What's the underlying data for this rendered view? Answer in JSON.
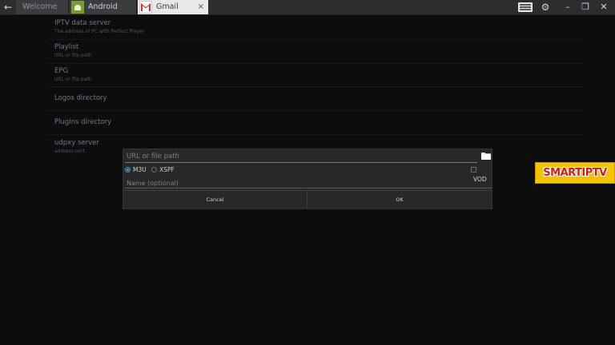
{
  "tabs": [
    {
      "label": "Welcome"
    },
    {
      "label": "Android"
    },
    {
      "label": "Gmail",
      "close": "×"
    }
  ],
  "icons": {
    "back": "←",
    "keyboard": "keyboard-icon",
    "settings": "⚙",
    "minimize": "–",
    "restore": "❐",
    "close": "✕"
  },
  "settings": [
    {
      "title": "IPTV data server",
      "subtitle": "The address of PC with Perfect Player"
    },
    {
      "title": "Playlist",
      "subtitle": "URL or file path"
    },
    {
      "title": "EPG",
      "subtitle": "URL or file path"
    },
    {
      "title": "Logos directory",
      "subtitle": ""
    },
    {
      "title": "Plugins directory",
      "subtitle": ""
    },
    {
      "title": "udpxy server",
      "subtitle": "address:port"
    }
  ],
  "dialog": {
    "url_placeholder": "URL or file path",
    "url_value": "",
    "format_options": [
      {
        "label": "M3U",
        "selected": true
      },
      {
        "label": "XSPF",
        "selected": false
      }
    ],
    "vod_label": "VOD",
    "vod_checked": false,
    "name_placeholder": "Name (optional)",
    "name_value": "",
    "cancel_label": "Cancel",
    "ok_label": "OK"
  },
  "logo": "SMARTIPTV",
  "colors": {
    "accent": "#35a6d9",
    "logo_bg": "#f3c300",
    "logo_text": "#d41a1a"
  }
}
